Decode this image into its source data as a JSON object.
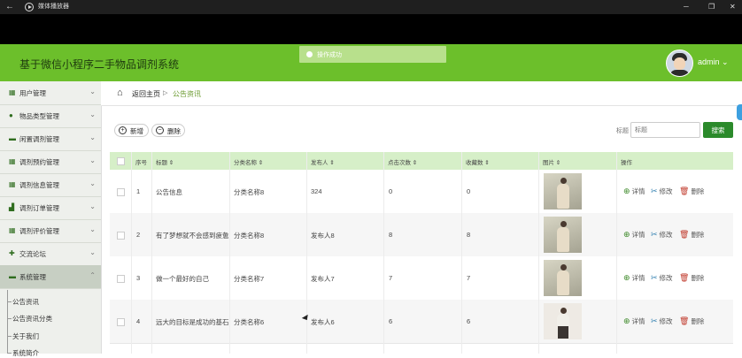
{
  "titlebar": {
    "title": "媒体播放器",
    "back_icon": "back-arrow-icon",
    "minimize": "─",
    "maximize": "❐",
    "close": "✕"
  },
  "header": {
    "app_title": "基于微信小程序二手物品调剂系统",
    "user": "admin ⌄",
    "brand_color": "#6cbf2b"
  },
  "toast": {
    "text": "操作成功"
  },
  "sidebar": {
    "items": [
      {
        "label": "用户管理",
        "icon": "grid-icon"
      },
      {
        "label": "物品类型管理",
        "icon": "user-icon"
      },
      {
        "label": "闲置调剂管理",
        "icon": "chat-icon"
      },
      {
        "label": "调剂预约管理",
        "icon": "grid-icon"
      },
      {
        "label": "调剂信息管理",
        "icon": "grid-icon"
      },
      {
        "label": "调剂订单管理",
        "icon": "chart-icon"
      },
      {
        "label": "调剂评价管理",
        "icon": "grid-icon"
      },
      {
        "label": "交流论坛",
        "icon": "forum-icon"
      },
      {
        "label": "系统管理",
        "icon": "system-icon"
      }
    ],
    "subitems": [
      "公告资讯",
      "公告资讯分类",
      "关于我们",
      "系统简介"
    ]
  },
  "breadcrumb": {
    "home": "返回主页",
    "separator": "▷",
    "current": "公告资讯"
  },
  "toolbar": {
    "add": "新增",
    "delete": "删除"
  },
  "search": {
    "label": "标题",
    "placeholder": "标题",
    "button": "搜索"
  },
  "table": {
    "headers": [
      "序号",
      "标题 ⇕",
      "分类名称 ⇕",
      "发布人 ⇕",
      "点击次数 ⇕",
      "收藏数 ⇕",
      "图片 ⇕",
      "操作"
    ],
    "rows": [
      {
        "id": "1",
        "title": "公告信息",
        "category": "分类名称8",
        "publisher": "324",
        "clicks": "0",
        "favorites": "0"
      },
      {
        "id": "2",
        "title": "有了梦想就不会感到疲惫",
        "category": "分类名称8",
        "publisher": "发布人8",
        "clicks": "8",
        "favorites": "8"
      },
      {
        "id": "3",
        "title": "做一个最好的自己",
        "category": "分类名称7",
        "publisher": "发布人7",
        "clicks": "7",
        "favorites": "7"
      },
      {
        "id": "4",
        "title": "远大的目标是成功的基石",
        "category": "分类名称6",
        "publisher": "发布人6",
        "clicks": "6",
        "favorites": "6"
      }
    ],
    "actions": {
      "view": "详情",
      "edit": "修改",
      "delete": "删除"
    }
  }
}
